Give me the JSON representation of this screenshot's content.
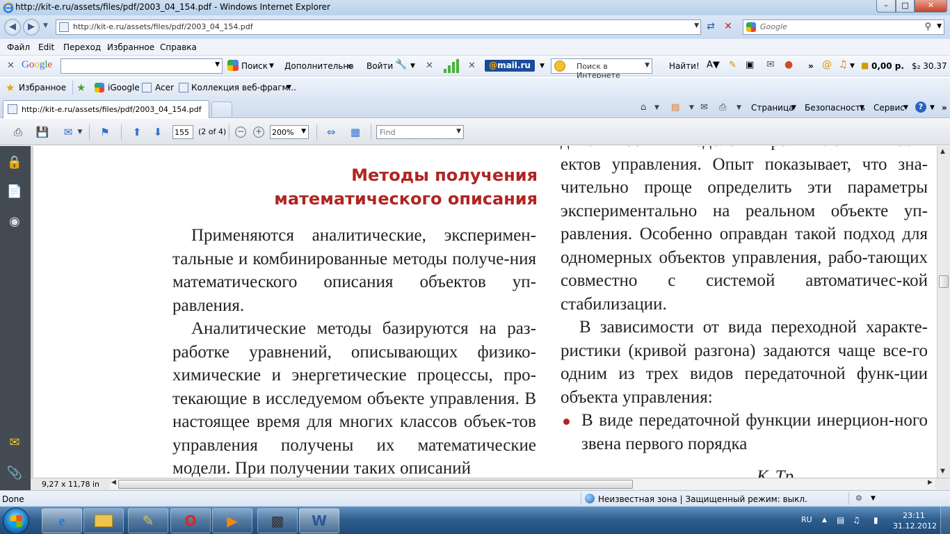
{
  "window": {
    "title": "http://kit-e.ru/assets/files/pdf/2003_04_154.pdf - Windows Internet Explorer",
    "controls": {
      "minimize": "–",
      "maximize": "□",
      "close": "✕"
    }
  },
  "address_bar": {
    "url": "http://kit-e.ru/assets/files/pdf/2003_04_154.pdf",
    "back": "◀",
    "forward": "▶",
    "refresh": "⇄",
    "stop": "✕"
  },
  "search_box": {
    "placeholder": "Google"
  },
  "menu": [
    "Файл",
    "Edit",
    "Переход",
    "Избранное",
    "Справка"
  ],
  "google_toolbar": {
    "logo": "Google",
    "search_label": "Поиск",
    "more_label": "Дополнительно",
    "more_arrows": "»",
    "signin": "Войти",
    "mailru_logo_prefix": "@",
    "mailru_logo_text": "mail.ru",
    "mailru_search_placeholder": "Поиск в Интернете",
    "find_button": "Найти!",
    "balance": "0,00 р.",
    "currency": "$₂ 30.37"
  },
  "favorites_bar": {
    "favorites_label": "Избранное",
    "items": [
      "iGoogle",
      "Acer",
      "Коллекция веб-фрагм..."
    ]
  },
  "tabs": [
    {
      "label": "http://kit-e.ru/assets/files/pdf/2003_04_154.pdf",
      "active": true
    }
  ],
  "command_bar": {
    "page": "Страница",
    "safety": "Безопасность",
    "tools": "Сервис",
    "help": "?"
  },
  "pdf_toolbar": {
    "page_number": "155",
    "page_count": "(2 of 4)",
    "zoom": "200%",
    "find_placeholder": "Find"
  },
  "document": {
    "heading_line1": "Методы получения",
    "heading_line2": "математического описания",
    "left_paragraphs": [
      "Применяются аналитические, эксперимен-тальные и комбинированные методы получе-ния математического описания объектов уп-равления.",
      "Аналитические методы базируются на раз-работке уравнений, описывающих физико-химические и энергетические процессы, про-текающие в исследуемом объекте управления. В настоящее время для многих классов объек-тов управления получены их математические модели. При получении таких описаний"
    ],
    "right_top": "динамических моделей промышленных объ-ектов управления. Опыт показывает, что зна-чительно проще определить эти параметры экспериментально на реальном объекте уп-равления. Особенно оправдан такой подход для одномерных объектов управления, рабо-тающих совместно с системой автоматичес-кой стабилизации.",
    "right_paragraph": "В зависимости от вида переходной характе-ристики (кривой разгона) задаются чаще все-го одним из трех видов передаточной функ-ции объекта управления:",
    "bullet_item": "В виде передаточной функции инерцион-ного звена первого порядка",
    "formula_fragment": "K  Tр"
  },
  "pdf_status": {
    "page_size": "9,27 x 11,78 in"
  },
  "ie_status": {
    "done": "Done",
    "zone": "Неизвестная зона | Защищенный режим: выкл.",
    "zoom_icon": "⚙"
  },
  "taskbar": {
    "apps": [
      "Internet Explorer",
      "Windows Explorer",
      "Paint",
      "Opera",
      "Media Player",
      "Scanner",
      "Microsoft Word"
    ],
    "language": "RU",
    "time": "23:11",
    "date": "31.12.2012"
  }
}
